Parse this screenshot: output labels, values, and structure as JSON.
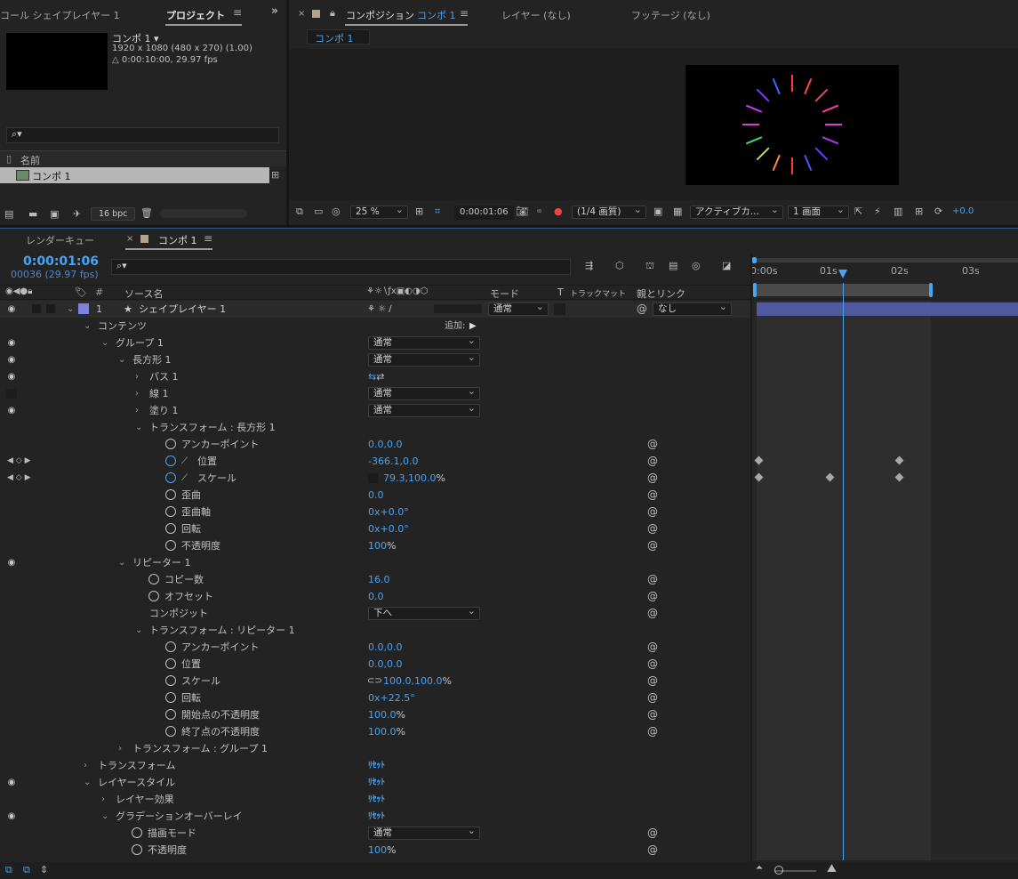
{
  "project_panel": {
    "tab_left": "コール シェイプレイヤー 1",
    "tab_project": "プロジェクト",
    "comp_name": "コンポ 1 ▾",
    "comp_info1": "1920 x 1080  (480 x 270) (1.00)",
    "comp_info2": "△ 0:00:10:00, 29.97 fps",
    "col_name": "名前",
    "item_name": "コンポ 1",
    "bpc": "16 bpc"
  },
  "comp_panel": {
    "tab_close": "×",
    "tab_comp_prefix": "コンポジション",
    "tab_comp_name": "コンポ 1",
    "tab_layer": "レイヤー (なし)",
    "tab_footage": "フッテージ (なし)",
    "breadcrumb": "コンポ 1",
    "zoom": "25 %",
    "timecode": "0:00:01:06",
    "resolution": "(1/4 画質)",
    "camera": "アクティブカ...",
    "views": "1 画面",
    "exposure": "+0.0"
  },
  "timeline": {
    "tab_render": "レンダーキュー",
    "tab_comp": "コンポ 1",
    "timecode": "0:00:01:06",
    "frame_fps": "00036 (29.97 fps)",
    "col_source": "ソース名",
    "col_mode": "モード",
    "col_t": "T",
    "col_trkmat": "トラックマット",
    "col_parent": "親とリンク",
    "add_label": "追加:",
    "ruler": [
      "0:00s",
      "01s",
      "02s",
      "03s"
    ]
  },
  "layer": {
    "num": "1",
    "name": "シェイプレイヤー 1",
    "mode": "通常",
    "parent": "なし"
  },
  "rows": [
    {
      "name": "コンテンツ"
    },
    {
      "name": "グループ 1",
      "mode": "通常"
    },
    {
      "name": "長方形 1",
      "mode": "通常"
    },
    {
      "name": "パス 1"
    },
    {
      "name": "線 1",
      "mode": "通常"
    },
    {
      "name": "塗り 1",
      "mode": "通常"
    },
    {
      "name": "トランスフォーム : 長方形 1"
    },
    {
      "name": "アンカーポイント",
      "value": "0.0,0.0"
    },
    {
      "name": "位置",
      "value": "-366.1,0.0"
    },
    {
      "name": "スケール",
      "value": "79.3,100.0",
      "unit": "%"
    },
    {
      "name": "歪曲",
      "value": "0.0"
    },
    {
      "name": "歪曲軸",
      "value": "0x+0.0°"
    },
    {
      "name": "回転",
      "value": "0x+0.0°"
    },
    {
      "name": "不透明度",
      "value": "100",
      "unit": "%"
    },
    {
      "name": "リピーター 1"
    },
    {
      "name": "コピー数",
      "value": "16.0"
    },
    {
      "name": "オフセット",
      "value": "0.0"
    },
    {
      "name": "コンポジット",
      "mode": "下へ"
    },
    {
      "name": "トランスフォーム : リピーター 1"
    },
    {
      "name": "アンカーポイント",
      "value": "0.0,0.0"
    },
    {
      "name": "位置",
      "value": "0.0,0.0"
    },
    {
      "name": "スケール",
      "value": "100.0,100.0",
      "unit": "%"
    },
    {
      "name": "回転",
      "value": "0x+22.5°"
    },
    {
      "name": "開始点の不透明度",
      "value": "100.0",
      "unit": "%"
    },
    {
      "name": "終了点の不透明度",
      "value": "100.0",
      "unit": "%"
    },
    {
      "name": "トランスフォーム : グループ 1"
    },
    {
      "name": "トランスフォーム",
      "reset": "ﾘｾｯﾄ"
    },
    {
      "name": "レイヤースタイル",
      "reset": "ﾘｾｯﾄ"
    },
    {
      "name": "レイヤー効果",
      "reset": "ﾘｾｯﾄ"
    },
    {
      "name": "グラデーションオーバーレイ",
      "reset": "ﾘｾｯﾄ"
    },
    {
      "name": "描画モード",
      "mode": "通常"
    },
    {
      "name": "不透明度",
      "value": "100",
      "unit": "%"
    }
  ],
  "colors": {
    "accent": "#4aa3f0",
    "layer_bar": "#4f5a9e",
    "label": "#7b83e0",
    "panel_bg": "#232323"
  }
}
